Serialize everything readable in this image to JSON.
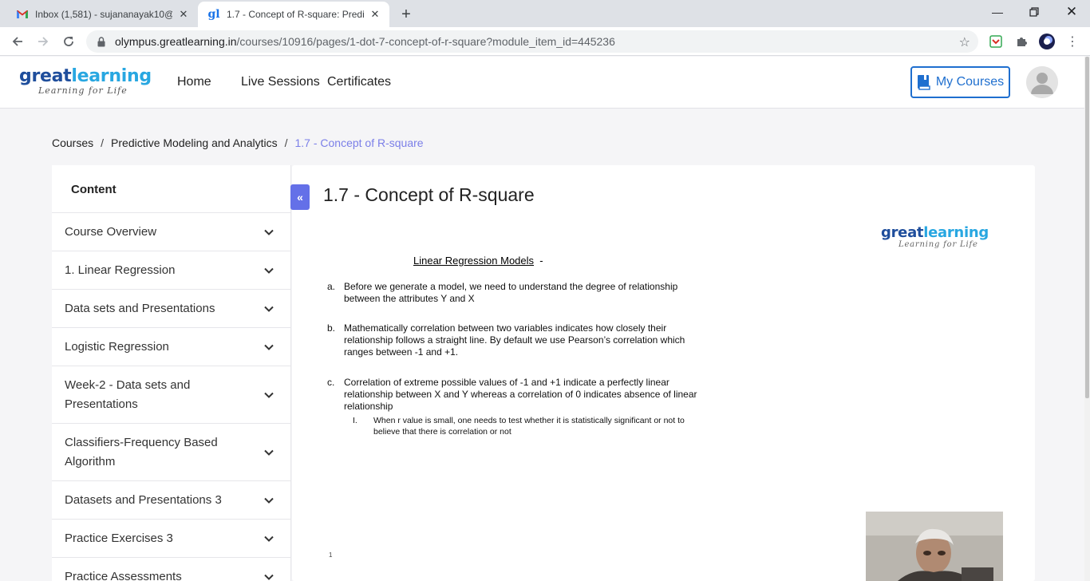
{
  "browser": {
    "tabs": [
      {
        "title": "Inbox (1,581) - sujananayak10@g",
        "favicon": "gmail-icon",
        "active": false
      },
      {
        "title": "1.7 - Concept of R-square: Predic",
        "favicon": "greatlearning-icon",
        "active": true
      }
    ],
    "url_host": "olympus.greatlearning.in",
    "url_path": "/courses/10916/pages/1-dot-7-concept-of-r-square?module_item_id=445236"
  },
  "header": {
    "logo": {
      "great": "great",
      "learning": "learning",
      "tagline": "Learning for Life"
    },
    "nav": [
      "Home",
      "Live Sessions",
      "Certificates"
    ],
    "my_courses": "My Courses"
  },
  "breadcrumb": {
    "items": [
      "Courses",
      "Predictive Modeling and Analytics"
    ],
    "separator": "/",
    "current": "1.7 - Concept of R-square"
  },
  "sidebar": {
    "heading": "Content",
    "collapse_symbol": "«",
    "modules": [
      "Course Overview",
      "1. Linear Regression",
      "Data sets and Presentations",
      "Logistic Regression",
      "Week-2 - Data sets and Presentations",
      "Classifiers-Frequency Based Algorithm",
      "Datasets and Presentations 3",
      "Practice Exercises 3",
      "Practice Assessments"
    ]
  },
  "main": {
    "title": "1.7 - Concept of R-square",
    "slide": {
      "logo": {
        "great": "great",
        "learning": "learning",
        "tagline": "Learning for Life"
      },
      "heading": "Linear Regression Models",
      "heading_suffix": "-",
      "items": [
        {
          "marker": "a.",
          "lines": [
            "Before we generate a model, we need to understand the degree of relationship",
            "between the attributes Y and X"
          ]
        },
        {
          "marker": "b.",
          "lines": [
            "Mathematically correlation between two variables indicates how closely their",
            "relationship follows a straight line. By default we use Pearson’s correlation which",
            "ranges between -1 and +1."
          ]
        },
        {
          "marker": "c.",
          "lines": [
            "Correlation of extreme possible values of -1 and +1 indicate a perfectly linear",
            "relationship between X and Y whereas a correlation of 0 indicates absence of linear",
            "relationship"
          ]
        }
      ],
      "subitem": {
        "marker": "I.",
        "lines": [
          "When r value is small, one needs to test whether it is statistically significant or not to",
          "believe that there is correlation or not"
        ]
      },
      "page_number": "1"
    }
  },
  "colors": {
    "accent": "#6470e8",
    "brand_dark": "#1f4e9c",
    "brand_light": "#28a7e1",
    "my_courses": "#1f6fcf"
  }
}
